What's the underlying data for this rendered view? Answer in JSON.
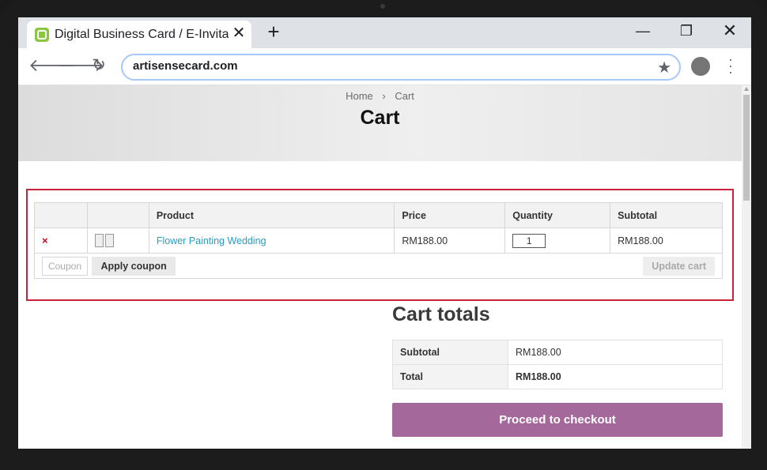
{
  "browser": {
    "tab_title": "Digital Business Card / E-Invitation",
    "tab_close": "✕",
    "new_tab": "+",
    "window_controls": {
      "minimize": "—",
      "restore": "❐",
      "close": "✕"
    },
    "url": "artisensecard.com",
    "icons": [
      "back-arrow-icon",
      "forward-arrow-icon",
      "reload-icon",
      "star-icon",
      "profile-avatar",
      "menu-dots-icon"
    ]
  },
  "page": {
    "breadcrumb": {
      "home": "Home",
      "separator": "›",
      "current": "Cart"
    },
    "title": "Cart"
  },
  "cart": {
    "headers": [
      "",
      "",
      "Product",
      "Price",
      "Quantity",
      "Subtotal"
    ],
    "items": [
      {
        "remove": "×",
        "product": "Flower Painting Wedding",
        "price": "RM188.00",
        "quantity": "1",
        "subtotal": "RM188.00"
      }
    ],
    "coupon_placeholder": "Coupon",
    "apply_coupon": "Apply coupon",
    "update_cart": "Update cart"
  },
  "totals": {
    "title": "Cart totals",
    "subtotal_label": "Subtotal",
    "subtotal_value": "RM188.00",
    "total_label": "Total",
    "total_value": "RM188.00",
    "checkout": "Proceed to checkout"
  },
  "colors": {
    "checkout_button": "#a4689a",
    "product_link": "#2a9dbf",
    "remove_icon": "#d0021b",
    "highlight_border": "#c8233a",
    "favicon": "#8cc63f"
  }
}
